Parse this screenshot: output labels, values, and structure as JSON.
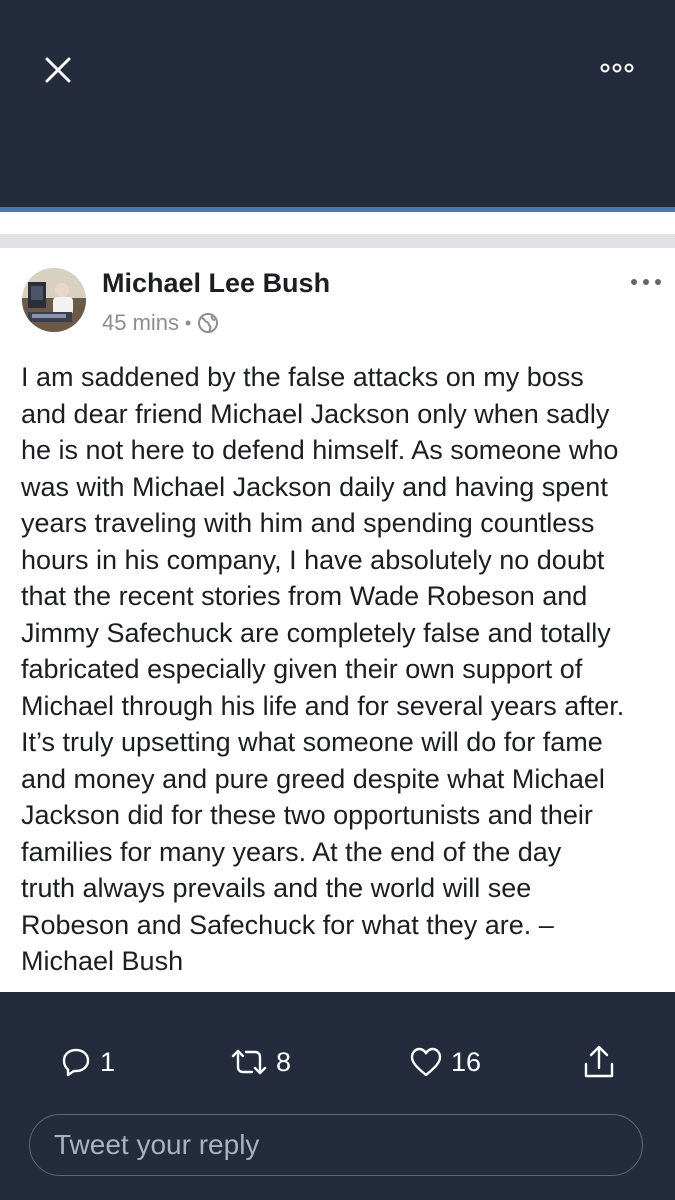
{
  "post": {
    "author": "Michael Lee Bush",
    "time": "45 mins",
    "separator": "•",
    "text": "I am saddened by the false attacks on my boss\nand dear friend Michael Jackson only when sadly\nhe is not here to defend himself.  As someone who\nwas with Michael Jackson daily and having spent\nyears traveling with him and spending countless\nhours in his company, I have absolutely no doubt\nthat the recent stories from Wade Robeson and\nJimmy Safechuck are completely false and totally\nfabricated especially given their own support of\nMichael through his life and for several years after.\nIt’s truly upsetting what someone will do for fame\nand money and pure greed despite what Michael\nJackson did for these two opportunists and their\nfamilies for many years.  At the end of the day\ntruth always prevails and the world will see\nRobeson and Safechuck for what they are.  –\nMichael Bush"
  },
  "actions": {
    "replies": "1",
    "retweets": "8",
    "likes": "16"
  },
  "reply": {
    "placeholder": "Tweet your reply"
  },
  "icons": {
    "close": "close-icon",
    "more": "more-horizontal-icon",
    "globe": "globe-icon",
    "reply": "reply-icon",
    "retweet": "retweet-icon",
    "like": "heart-icon",
    "share": "share-icon"
  },
  "colors": {
    "dark_background": "#232b3d",
    "accent": "#4a78b5",
    "card": "#ffffff",
    "text": "#1c1e21",
    "meta": "#8a8d91"
  }
}
